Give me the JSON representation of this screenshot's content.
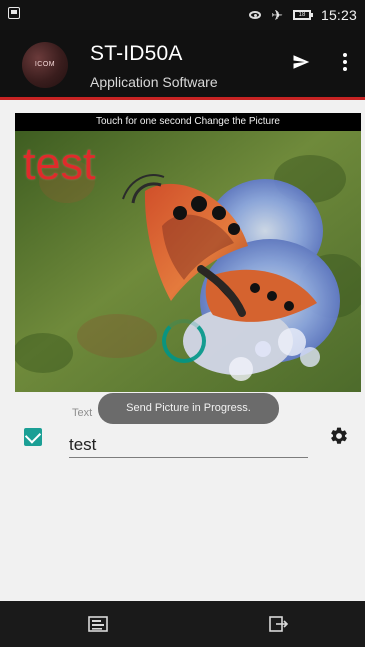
{
  "status_bar": {
    "battery_level": "18",
    "time": "15:23",
    "icons": [
      "screenshot-icon",
      "visibility-icon",
      "airplane-icon",
      "battery-icon"
    ]
  },
  "app_bar": {
    "logo_text": "ICOM",
    "title": "ST-ID50A",
    "subtitle": "Application Software",
    "accent_color": "#c82323",
    "actions": [
      "send-icon",
      "more-vertical-icon"
    ]
  },
  "picture": {
    "hint": "Touch for one second Change the Picture",
    "overlay_text": "test",
    "overlay_text_color": "#df2b2b",
    "loading": true
  },
  "form": {
    "checkbox_checked": true,
    "label": "Text",
    "value": "test",
    "placeholder": "",
    "settings_icon": "gear-icon"
  },
  "toast": {
    "message": "Send Picture in Progress."
  },
  "bottom_nav": {
    "items": [
      "image-import-icon",
      "image-export-icon"
    ]
  }
}
